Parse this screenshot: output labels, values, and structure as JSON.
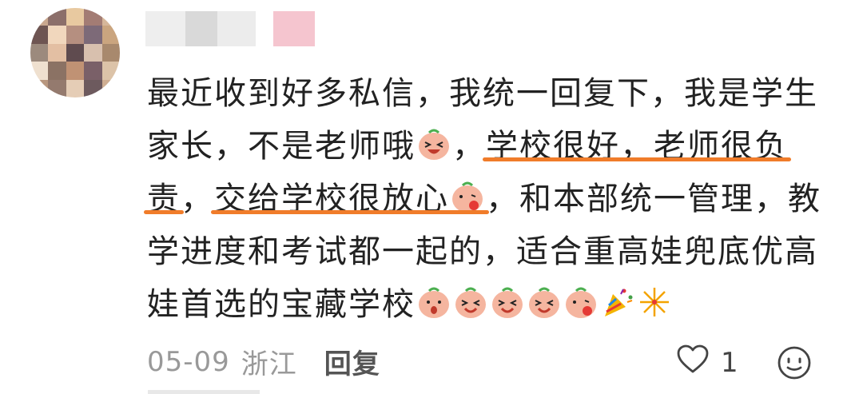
{
  "comment": {
    "lines": [
      [
        "最近收到好多私信，我统一回复下，我是学生"
      ],
      [
        "家长，不是老师哦",
        "，",
        "学校很好，老师很负"
      ],
      [
        "责",
        "，",
        "交给学校很放心",
        "，和本部统一管理，教"
      ],
      [
        "学进度和考试都一起的，适合重高娃兜底优高"
      ],
      [
        "娃首选的宝藏学校"
      ]
    ]
  },
  "meta": {
    "date": "05-09",
    "location": "浙江",
    "reply_label": "回复"
  },
  "like": {
    "count": "1"
  },
  "icons": {
    "like": "heart-outline-icon",
    "emoji_button": "smiley-face-icon"
  },
  "colors": {
    "highlight": "#f07c2a",
    "text": "#222222",
    "meta": "#999999"
  }
}
